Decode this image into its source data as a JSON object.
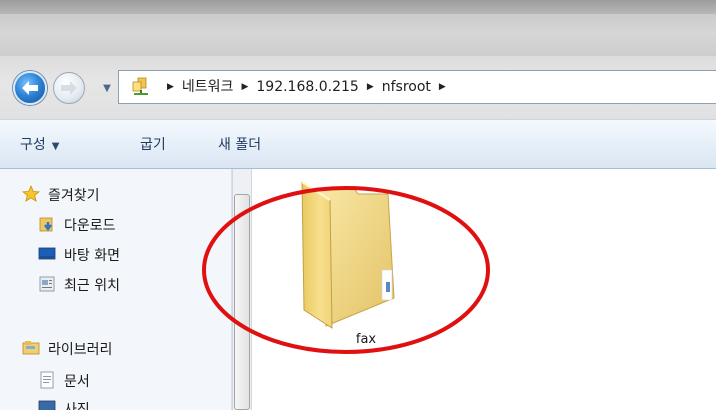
{
  "address": {
    "crumbs": [
      "네트워크",
      "192.168.0.215",
      "nfsroot"
    ]
  },
  "toolbar": {
    "organize": "구성",
    "burn": "굽기",
    "new_folder": "새 폴더"
  },
  "sidebar": {
    "favorites_header": "즐겨찾기",
    "items": [
      "다운로드",
      "바탕 화면",
      "최근 위치"
    ],
    "libraries_header": "라이브러리",
    "library_items": [
      "문서",
      "사진"
    ]
  },
  "content": {
    "folders": [
      {
        "name": "fax",
        "icon": "folder-icon"
      }
    ]
  },
  "annotation": {
    "circle_color": "#e01010"
  },
  "colors": {
    "toolbar_text": "#1e3a5f",
    "back_button": "#2f86d6"
  }
}
